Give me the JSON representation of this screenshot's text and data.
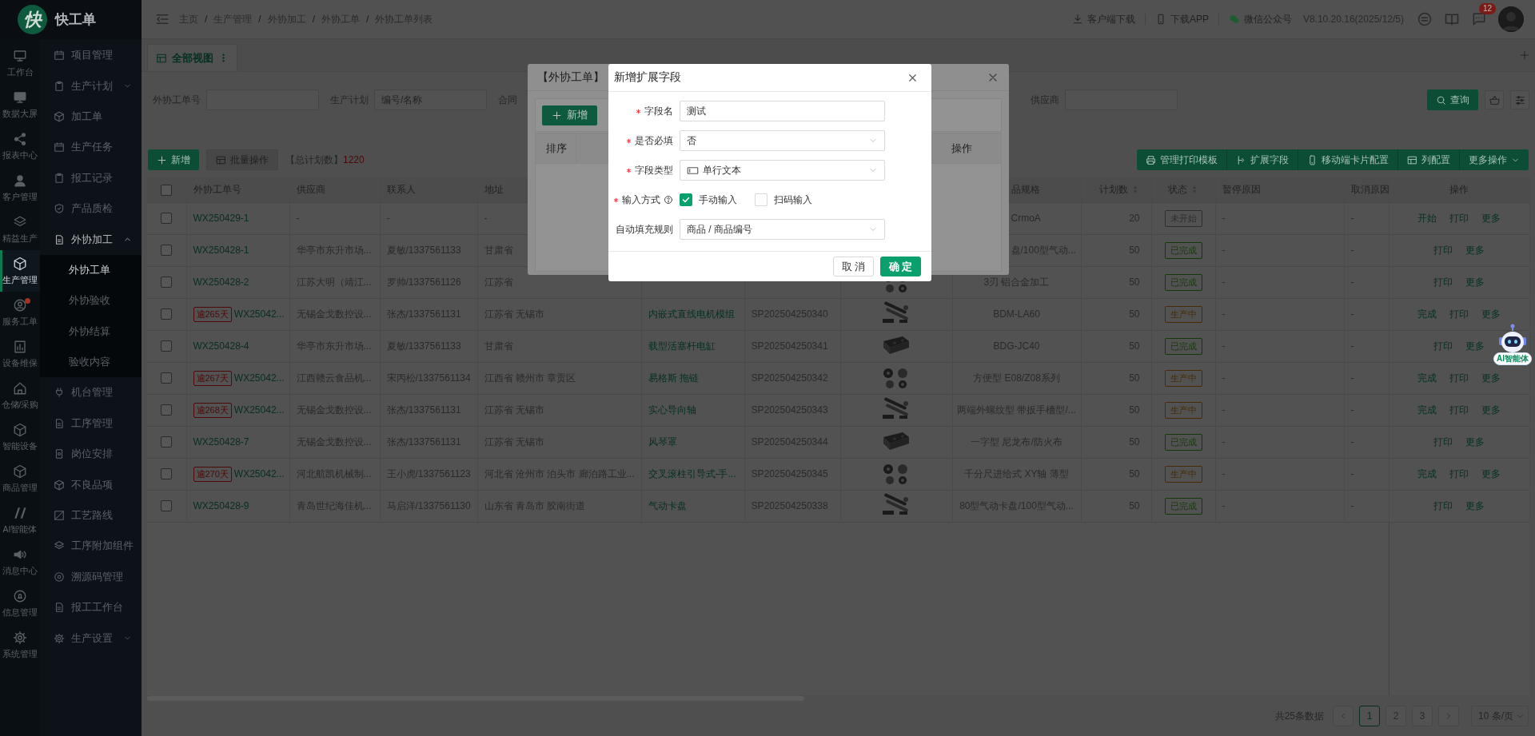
{
  "logo": {
    "glyph": "快",
    "title": "快工单"
  },
  "rail": [
    {
      "label": "工作台",
      "selected": false,
      "dot": false
    },
    {
      "label": "数据大屏",
      "selected": false,
      "dot": false
    },
    {
      "label": "报表中心",
      "selected": false,
      "dot": false
    },
    {
      "label": "客户管理",
      "selected": false,
      "dot": false
    },
    {
      "label": "精益生产",
      "selected": false,
      "dot": false
    },
    {
      "label": "生产管理",
      "selected": true,
      "dot": false
    },
    {
      "label": "服务工单",
      "selected": false,
      "dot": true
    },
    {
      "label": "设备维保",
      "selected": false,
      "dot": false
    },
    {
      "label": "仓储/采购",
      "selected": false,
      "dot": false
    },
    {
      "label": "智能设备",
      "selected": false,
      "dot": false
    },
    {
      "label": "商品管理",
      "selected": false,
      "dot": false
    },
    {
      "label": "AI智能体",
      "selected": false,
      "dot": false
    },
    {
      "label": "消息中心",
      "selected": false,
      "dot": false
    },
    {
      "label": "信息管理",
      "selected": false,
      "dot": false
    },
    {
      "label": "系统管理",
      "selected": false,
      "dot": false
    }
  ],
  "menu": [
    {
      "label": "项目管理"
    },
    {
      "label": "生产计划",
      "expanded": false
    },
    {
      "label": "加工单"
    },
    {
      "label": "生产任务"
    },
    {
      "label": "报工记录"
    },
    {
      "label": "产品质检"
    },
    {
      "label": "外协加工",
      "expanded": true,
      "children": [
        {
          "label": "外协工单",
          "selected": true
        },
        {
          "label": "外协验收",
          "selected": false
        },
        {
          "label": "外协结算",
          "selected": false
        },
        {
          "label": "验收内容",
          "selected": false
        }
      ]
    },
    {
      "label": "机台管理"
    },
    {
      "label": "工序管理"
    },
    {
      "label": "岗位安排"
    },
    {
      "label": "不良品项"
    },
    {
      "label": "工艺路线"
    },
    {
      "label": "工序附加组件"
    },
    {
      "label": "溯源码管理"
    },
    {
      "label": "报工工作台"
    },
    {
      "label": "生产设置",
      "expanded": false
    }
  ],
  "header": {
    "breadcrumb": [
      "主页",
      "生产管理",
      "外协加工",
      "外协工单",
      "外协工单列表"
    ],
    "separator": "/",
    "links": [
      "客户端下载",
      "下载APP",
      "微信公众号"
    ],
    "version": "V8.10.20.16(2025/12/5)",
    "badge": "12"
  },
  "view_tabs": [
    {
      "label": "全部视图",
      "selected": true
    }
  ],
  "filters": [
    {
      "kind": "input",
      "label": "外协工单号"
    },
    {
      "kind": "input",
      "label": "生产计划",
      "placeholder": "编号/名称"
    },
    {
      "kind": "label",
      "label": "合同"
    },
    {
      "kind": "input",
      "label": "供应商"
    }
  ],
  "search_button": "查询",
  "toolbar": {
    "add": "新增",
    "batch": {
      "label": "批量操作",
      "disabled": true
    },
    "total_label": "【总计划数】",
    "total": "1220",
    "actions": [
      "管理打印模板",
      "扩展字段",
      "移动端卡片配置",
      "列配置",
      "更多操作"
    ]
  },
  "table": {
    "all_checked": false,
    "columns": {
      "order_no": "外协工单号",
      "supplier": "供应商",
      "contact": "联系人",
      "address": "地址",
      "spec": "品规格",
      "planned": "计划数",
      "status": "状态",
      "pause_reason": "暂停原因",
      "cancel_reason": "取消原因",
      "actions": "操作"
    },
    "rows": [
      {
        "checked": false,
        "order_no": "WX250429-1",
        "supplier": "-",
        "contact": "-",
        "address": "-",
        "spec": "CrmoA",
        "planned": "20",
        "status": {
          "label": "未开始",
          "color": "#2e2e2e"
        },
        "pause_reason": "-",
        "cancel_reason": "-",
        "actions": [
          "开始",
          "打印",
          "更多"
        ]
      },
      {
        "checked": false,
        "order_no": "WX250428-1",
        "supplier": "华亭市东升市场...",
        "contact": "夏敏/1337561133",
        "address": "甘肃省",
        "spec": "盘/100型气动...",
        "planned": "50",
        "status": {
          "label": "已完成",
          "color": "#123a05"
        },
        "pause_reason": "-",
        "cancel_reason": "-",
        "actions": [
          "打印",
          "更多"
        ]
      },
      {
        "checked": false,
        "order_no": "WX250428-2",
        "supplier": "江苏大明（靖江...",
        "contact": "罗帅/1337561126",
        "address": "江苏省",
        "column_8": {
          "kind": "picture"
        },
        "spec": "3刃 铝合金加工",
        "planned": "50",
        "status": {
          "label": "已完成",
          "color": "#123a05"
        },
        "pause_reason": "-",
        "cancel_reason": "-",
        "actions": [
          "打印",
          "更多"
        ]
      },
      {
        "checked": false,
        "overdue": "逾265天",
        "order_no": "WX25042...",
        "supplier": "无锡金戈数控设...",
        "contact": "张杰/1337561131",
        "address": "江苏省 无锡市",
        "column_6": "内嵌式直线电机模组",
        "column_7": "SP202504250340",
        "column_8": {
          "kind": "picture"
        },
        "spec": "BDM-LA60",
        "planned": "50",
        "status": {
          "label": "生产中",
          "color": "#4a2a02"
        },
        "pause_reason": "-",
        "cancel_reason": "-",
        "actions": [
          "完成",
          "打印",
          "更多"
        ]
      },
      {
        "checked": false,
        "order_no": "WX250428-4",
        "supplier": "华亭市东升市场...",
        "contact": "夏敏/1337561133",
        "address": "甘肃省",
        "column_6": "载型活塞杆电缸",
        "column_7": "SP202504250341",
        "column_8": {
          "kind": "picture"
        },
        "spec": "BDG-JC40",
        "planned": "50",
        "status": {
          "label": "已完成",
          "color": "#123a05"
        },
        "pause_reason": "-",
        "cancel_reason": "-",
        "actions": [
          "打印",
          "更多"
        ]
      },
      {
        "checked": false,
        "overdue": "逾267天",
        "order_no": "WX25042...",
        "supplier": "江西赣云食品机...",
        "contact": "宋丙松/1337561134",
        "address": "江西省 赣州市 章贡区",
        "column_6": "易格斯 拖链",
        "column_7": "SP202504250342",
        "column_8": {
          "kind": "picture"
        },
        "spec": "方便型 E08/Z08系列",
        "planned": "50",
        "status": {
          "label": "生产中",
          "color": "#4a2a02"
        },
        "pause_reason": "-",
        "cancel_reason": "-",
        "actions": [
          "完成",
          "打印",
          "更多"
        ]
      },
      {
        "checked": false,
        "overdue": "逾268天",
        "order_no": "WX25042...",
        "supplier": "无锡金戈数控设...",
        "contact": "张杰/1337561131",
        "address": "江苏省 无锡市",
        "column_6": "实心导向轴",
        "column_7": "SP202504250343",
        "column_8": {
          "kind": "picture"
        },
        "spec": "两端外螺纹型 带扳手槽型/...",
        "planned": "50",
        "status": {
          "label": "生产中",
          "color": "#4a2a02"
        },
        "pause_reason": "-",
        "cancel_reason": "-",
        "actions": [
          "完成",
          "打印",
          "更多"
        ]
      },
      {
        "checked": false,
        "order_no": "WX250428-7",
        "supplier": "无锡金戈数控设...",
        "contact": "张杰/1337561131",
        "address": "江苏省 无锡市",
        "column_6": "风琴罩",
        "column_7": "SP202504250344",
        "column_8": {
          "kind": "picture"
        },
        "spec": "一字型 尼龙布/防火布",
        "planned": "50",
        "status": {
          "label": "已完成",
          "color": "#123a05"
        },
        "pause_reason": "-",
        "cancel_reason": "-",
        "actions": [
          "打印",
          "更多"
        ]
      },
      {
        "checked": false,
        "overdue": "逾270天",
        "order_no": "WX25042...",
        "supplier": "河北航凯机械制...",
        "contact": "王小虎/1337561123",
        "address": "河北省 沧州市 泊头市 廊泊路工业...",
        "column_6": "交叉滚柱引导式-手...",
        "column_7": "SP202504250345",
        "column_8": {
          "kind": "picture"
        },
        "spec": "千分尺进给式 XY轴 薄型",
        "planned": "50",
        "status": {
          "label": "生产中",
          "color": "#4a2a02"
        },
        "pause_reason": "-",
        "cancel_reason": "-",
        "actions": [
          "完成",
          "打印",
          "更多"
        ]
      },
      {
        "checked": false,
        "order_no": "WX250428-9",
        "supplier": "青岛世纪海佳机...",
        "contact": "马启洋/1337561130",
        "address": "山东省 青岛市 胶南街道",
        "column_6": "气动卡盘",
        "column_7": "SP202504250338",
        "column_8": {
          "kind": "picture"
        },
        "spec": "80型气动卡盘/100型气动...",
        "planned": "50",
        "status": {
          "label": "已完成",
          "color": "#123a05"
        },
        "pause_reason": "-",
        "cancel_reason": "-",
        "actions": [
          "打印",
          "更多"
        ]
      }
    ]
  },
  "pagination": {
    "summary": "共25条数据",
    "pages": [
      {
        "label": "1",
        "selected": true
      },
      {
        "label": "2",
        "selected": false
      },
      {
        "label": "3",
        "selected": false
      }
    ],
    "page_size": "10 条/页"
  },
  "assistant": {
    "label": "AI智能体"
  },
  "back_dialog": {
    "title": "【外协工单】",
    "add_button": "新增",
    "columns": [
      "排序",
      "操作"
    ]
  },
  "dialog": {
    "title": "新增扩展字段",
    "fields": [
      {
        "kind": "input",
        "label": "字段名",
        "required": true,
        "help": false,
        "value": "测试"
      },
      {
        "kind": "select",
        "label": "是否必填",
        "required": true,
        "help": false,
        "value": "否"
      },
      {
        "kind": "select",
        "label": "字段类型",
        "required": true,
        "help": false,
        "value": "单行文本"
      },
      {
        "kind": "checks",
        "label": "输入方式",
        "required": true,
        "help": true,
        "options": [
          {
            "label": "手动输入",
            "checked": true
          },
          {
            "label": "扫码输入",
            "checked": false
          }
        ]
      },
      {
        "kind": "select",
        "label": "自动填充规则",
        "required": false,
        "help": false,
        "value": "商品 / 商品编号"
      }
    ],
    "buttons": [
      {
        "label": "取 消",
        "primary": false
      },
      {
        "label": "确 定",
        "primary": true
      }
    ]
  }
}
